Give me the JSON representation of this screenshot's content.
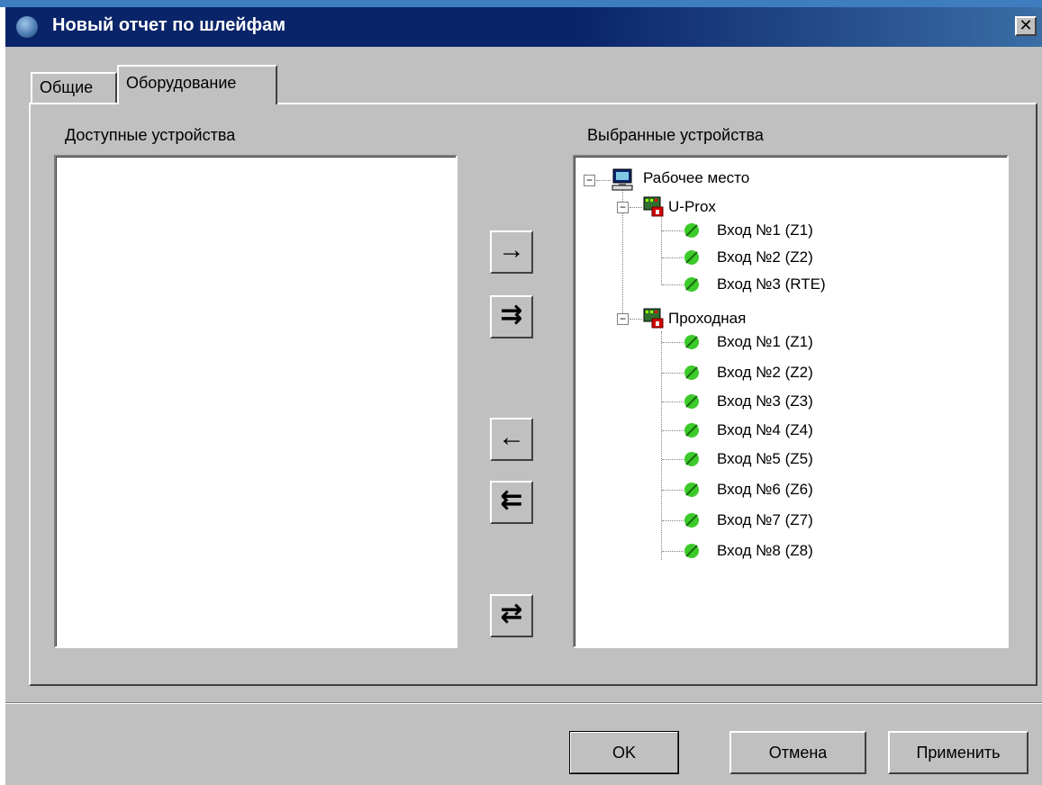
{
  "window": {
    "title": "Новый отчет по шлейфам",
    "close_glyph": "✕"
  },
  "tabs": [
    {
      "label": "Общие",
      "active": false
    },
    {
      "label": "Оборудование",
      "active": true
    }
  ],
  "available": {
    "label": "Доступные устройства",
    "items": []
  },
  "selected": {
    "label": "Выбранные устройства",
    "tree": {
      "root": "Рабочее место",
      "controllers": [
        {
          "name": "U-Prox",
          "zones": [
            "Вход №1 (Z1)",
            "Вход №2 (Z2)",
            "Вход №3 (RTE)"
          ]
        },
        {
          "name": "Проходная",
          "zones": [
            "Вход №1 (Z1)",
            "Вход №2 (Z2)",
            "Вход №3 (Z3)",
            "Вход №4 (Z4)",
            "Вход №5 (Z5)",
            "Вход №6 (Z6)",
            "Вход №7 (Z7)",
            "Вход №8 (Z8)"
          ]
        }
      ]
    }
  },
  "transfer_buttons": {
    "add_one": "→",
    "add_all": "⇉",
    "remove_one": "←",
    "remove_all": "⇇",
    "swap": "⇄"
  },
  "footer": {
    "ok": "OK",
    "cancel": "Отмена",
    "apply": "Применить"
  },
  "colors": {
    "face": "#c0c0c0",
    "titlebar": "#0a246a",
    "zone_icon": "#3ccb2a"
  }
}
